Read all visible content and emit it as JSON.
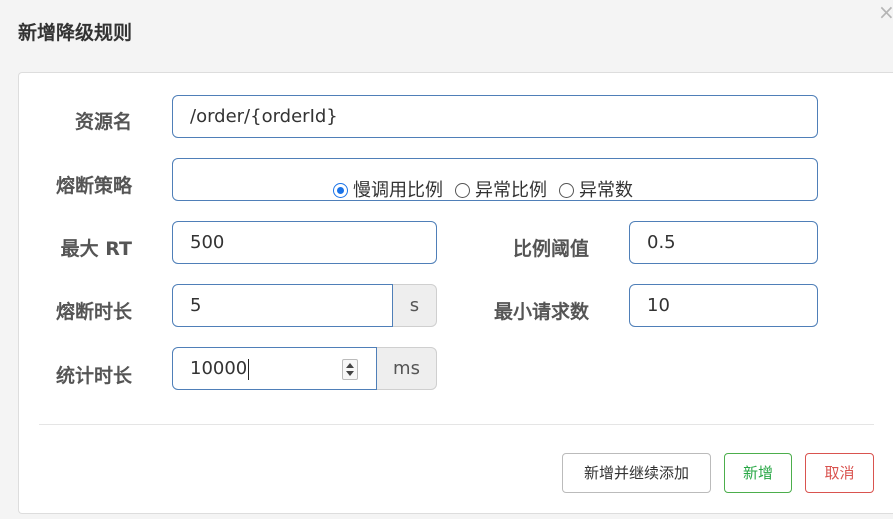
{
  "dialog": {
    "title": "新增降级规则",
    "close_symbol": "×"
  },
  "form": {
    "resource": {
      "label": "资源名",
      "value": "/order/{orderId}"
    },
    "strategy": {
      "label": "熔断策略",
      "options": [
        {
          "label": "慢调用比例",
          "checked": true
        },
        {
          "label": "异常比例",
          "checked": false
        },
        {
          "label": "异常数",
          "checked": false
        }
      ]
    },
    "max_rt": {
      "label": "最大 RT",
      "value": "500"
    },
    "ratio_threshold": {
      "label": "比例阈值",
      "value": "0.5"
    },
    "break_duration": {
      "label": "熔断时长",
      "value": "5",
      "unit": "s"
    },
    "min_requests": {
      "label": "最小请求数",
      "value": "10"
    },
    "stat_duration": {
      "label": "统计时长",
      "value": "10000",
      "unit": "ms"
    }
  },
  "buttons": {
    "add_continue": "新增并继续添加",
    "add": "新增",
    "cancel": "取消"
  },
  "colors": {
    "input_border": "#4f7fb8",
    "radio_checked": "#1a73e8",
    "success": "#28a745",
    "danger": "#d9534f"
  }
}
